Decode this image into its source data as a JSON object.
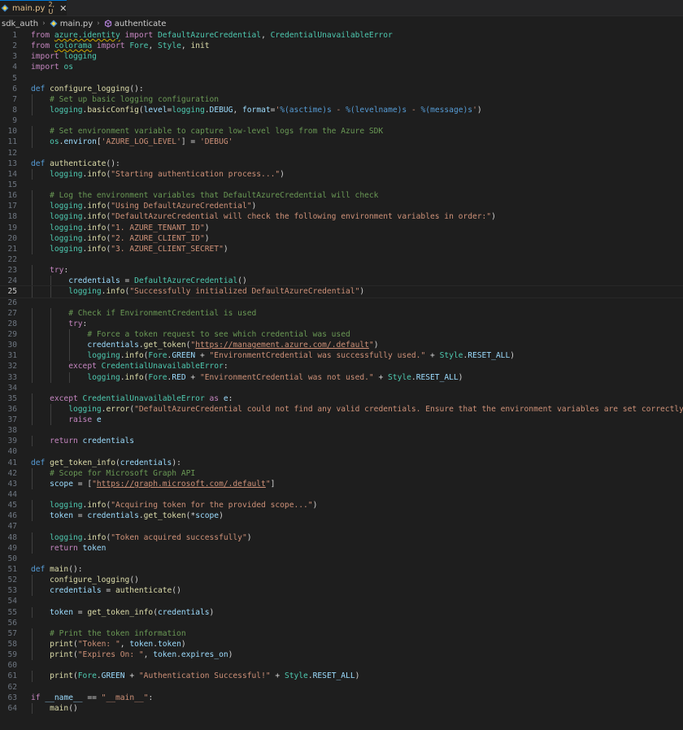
{
  "tab": {
    "filename": "main.py",
    "status": "2, U",
    "close_glyph": "✕",
    "file_icon": "python-icon",
    "accent": "#0078d4"
  },
  "breadcrumb": {
    "folder": "sdk_auth",
    "file": "main.py",
    "symbol": "authenticate",
    "separator": "›"
  },
  "editor": {
    "current_line": 25,
    "lines": [
      [
        [
          "kw",
          "from"
        ],
        [
          "pl",
          " "
        ],
        [
          "mod_sq",
          "azure.identity"
        ],
        [
          "pl",
          " "
        ],
        [
          "kw",
          "import"
        ],
        [
          "pl",
          " "
        ],
        [
          "cls",
          "DefaultAzureCredential"
        ],
        [
          "pl",
          ", "
        ],
        [
          "cls",
          "CredentialUnavailableError"
        ]
      ],
      [
        [
          "kw",
          "from"
        ],
        [
          "pl",
          " "
        ],
        [
          "mod_sq",
          "colorama"
        ],
        [
          "pl",
          " "
        ],
        [
          "kw",
          "import"
        ],
        [
          "pl",
          " "
        ],
        [
          "cls",
          "Fore"
        ],
        [
          "pl",
          ", "
        ],
        [
          "cls",
          "Style"
        ],
        [
          "pl",
          ", "
        ],
        [
          "fn",
          "init"
        ]
      ],
      [
        [
          "kw",
          "import"
        ],
        [
          "pl",
          " "
        ],
        [
          "mod",
          "logging"
        ]
      ],
      [
        [
          "kw",
          "import"
        ],
        [
          "pl",
          " "
        ],
        [
          "mod",
          "os"
        ]
      ],
      [],
      [
        [
          "def",
          "def"
        ],
        [
          "pl",
          " "
        ],
        [
          "fn",
          "configure_logging"
        ],
        [
          "pl",
          "():"
        ]
      ],
      [
        [
          "pl",
          "    "
        ],
        [
          "cmt",
          "# Set up basic logging configuration"
        ]
      ],
      [
        [
          "pl",
          "    "
        ],
        [
          "mod",
          "logging"
        ],
        [
          "pl",
          "."
        ],
        [
          "fn",
          "basicConfig"
        ],
        [
          "pl",
          "("
        ],
        [
          "var",
          "level"
        ],
        [
          "pl",
          "="
        ],
        [
          "mod",
          "logging"
        ],
        [
          "pl",
          "."
        ],
        [
          "var",
          "DEBUG"
        ],
        [
          "pl",
          ", "
        ],
        [
          "var",
          "format"
        ],
        [
          "pl",
          "="
        ],
        [
          "str",
          "'"
        ],
        [
          "fmt",
          "%(asctime)s"
        ],
        [
          "str",
          " - "
        ],
        [
          "fmt",
          "%(levelname)s"
        ],
        [
          "str",
          " - "
        ],
        [
          "fmt",
          "%(message)s"
        ],
        [
          "str",
          "'"
        ],
        [
          "pl",
          ")"
        ]
      ],
      [],
      [
        [
          "pl",
          "    "
        ],
        [
          "cmt",
          "# Set environment variable to capture low-level logs from the Azure SDK"
        ]
      ],
      [
        [
          "pl",
          "    "
        ],
        [
          "mod",
          "os"
        ],
        [
          "pl",
          "."
        ],
        [
          "var",
          "environ"
        ],
        [
          "pl",
          "["
        ],
        [
          "str",
          "'AZURE_LOG_LEVEL'"
        ],
        [
          "pl",
          "] = "
        ],
        [
          "str",
          "'DEBUG'"
        ]
      ],
      [],
      [
        [
          "def",
          "def"
        ],
        [
          "pl",
          " "
        ],
        [
          "fn",
          "authenticate"
        ],
        [
          "pl",
          "():"
        ]
      ],
      [
        [
          "pl",
          "    "
        ],
        [
          "mod",
          "logging"
        ],
        [
          "pl",
          "."
        ],
        [
          "fn",
          "info"
        ],
        [
          "pl",
          "("
        ],
        [
          "str",
          "\"Starting authentication process...\""
        ],
        [
          "pl",
          ")"
        ]
      ],
      [],
      [
        [
          "pl",
          "    "
        ],
        [
          "cmt",
          "# Log the environment variables that DefaultAzureCredential will check"
        ]
      ],
      [
        [
          "pl",
          "    "
        ],
        [
          "mod",
          "logging"
        ],
        [
          "pl",
          "."
        ],
        [
          "fn",
          "info"
        ],
        [
          "pl",
          "("
        ],
        [
          "str",
          "\"Using DefaultAzureCredential\""
        ],
        [
          "pl",
          ")"
        ]
      ],
      [
        [
          "pl",
          "    "
        ],
        [
          "mod",
          "logging"
        ],
        [
          "pl",
          "."
        ],
        [
          "fn",
          "info"
        ],
        [
          "pl",
          "("
        ],
        [
          "str",
          "\"DefaultAzureCredential will check the following environment variables in order:\""
        ],
        [
          "pl",
          ")"
        ]
      ],
      [
        [
          "pl",
          "    "
        ],
        [
          "mod",
          "logging"
        ],
        [
          "pl",
          "."
        ],
        [
          "fn",
          "info"
        ],
        [
          "pl",
          "("
        ],
        [
          "str",
          "\"1. AZURE_TENANT_ID\""
        ],
        [
          "pl",
          ")"
        ]
      ],
      [
        [
          "pl",
          "    "
        ],
        [
          "mod",
          "logging"
        ],
        [
          "pl",
          "."
        ],
        [
          "fn",
          "info"
        ],
        [
          "pl",
          "("
        ],
        [
          "str",
          "\"2. AZURE_CLIENT_ID\""
        ],
        [
          "pl",
          ")"
        ]
      ],
      [
        [
          "pl",
          "    "
        ],
        [
          "mod",
          "logging"
        ],
        [
          "pl",
          "."
        ],
        [
          "fn",
          "info"
        ],
        [
          "pl",
          "("
        ],
        [
          "str",
          "\"3. AZURE_CLIENT_SECRET\""
        ],
        [
          "pl",
          ")"
        ]
      ],
      [],
      [
        [
          "pl",
          "    "
        ],
        [
          "kw",
          "try"
        ],
        [
          "pl",
          ":"
        ]
      ],
      [
        [
          "pl",
          "        "
        ],
        [
          "var",
          "credentials"
        ],
        [
          "pl",
          " = "
        ],
        [
          "cls",
          "DefaultAzureCredential"
        ],
        [
          "pl",
          "()"
        ]
      ],
      [
        [
          "pl",
          "        "
        ],
        [
          "mod",
          "logging"
        ],
        [
          "pl",
          "."
        ],
        [
          "fn",
          "info"
        ],
        [
          "pl",
          "("
        ],
        [
          "str",
          "\"Successfully initialized DefaultAzureCredential\""
        ],
        [
          "pl",
          ")"
        ]
      ],
      [],
      [
        [
          "pl",
          "        "
        ],
        [
          "cmt",
          "# Check if EnvironmentCredential is used"
        ]
      ],
      [
        [
          "pl",
          "        "
        ],
        [
          "kw",
          "try"
        ],
        [
          "pl",
          ":"
        ]
      ],
      [
        [
          "pl",
          "            "
        ],
        [
          "cmt",
          "# Force a token request to see which credential was used"
        ]
      ],
      [
        [
          "pl",
          "            "
        ],
        [
          "var",
          "credentials"
        ],
        [
          "pl",
          "."
        ],
        [
          "fn",
          "get_token"
        ],
        [
          "pl",
          "("
        ],
        [
          "str",
          "\""
        ],
        [
          "str_u",
          "https://management.azure.com/.default"
        ],
        [
          "str",
          "\""
        ],
        [
          "pl",
          ")"
        ]
      ],
      [
        [
          "pl",
          "            "
        ],
        [
          "mod",
          "logging"
        ],
        [
          "pl",
          "."
        ],
        [
          "fn",
          "info"
        ],
        [
          "pl",
          "("
        ],
        [
          "cls",
          "Fore"
        ],
        [
          "pl",
          "."
        ],
        [
          "var",
          "GREEN"
        ],
        [
          "pl",
          " + "
        ],
        [
          "str",
          "\"EnvironmentCredential was successfully used.\""
        ],
        [
          "pl",
          " + "
        ],
        [
          "cls",
          "Style"
        ],
        [
          "pl",
          "."
        ],
        [
          "var",
          "RESET_ALL"
        ],
        [
          "pl",
          ")"
        ]
      ],
      [
        [
          "pl",
          "        "
        ],
        [
          "kw",
          "except"
        ],
        [
          "pl",
          " "
        ],
        [
          "cls",
          "CredentialUnavailableError"
        ],
        [
          "pl",
          ":"
        ]
      ],
      [
        [
          "pl",
          "            "
        ],
        [
          "mod",
          "logging"
        ],
        [
          "pl",
          "."
        ],
        [
          "fn",
          "info"
        ],
        [
          "pl",
          "("
        ],
        [
          "cls",
          "Fore"
        ],
        [
          "pl",
          "."
        ],
        [
          "var",
          "RED"
        ],
        [
          "pl",
          " + "
        ],
        [
          "str",
          "\"EnvironmentCredential was not used.\""
        ],
        [
          "pl",
          " + "
        ],
        [
          "cls",
          "Style"
        ],
        [
          "pl",
          "."
        ],
        [
          "var",
          "RESET_ALL"
        ],
        [
          "pl",
          ")"
        ]
      ],
      [],
      [
        [
          "pl",
          "    "
        ],
        [
          "kw",
          "except"
        ],
        [
          "pl",
          " "
        ],
        [
          "cls",
          "CredentialUnavailableError"
        ],
        [
          "pl",
          " "
        ],
        [
          "kw",
          "as"
        ],
        [
          "pl",
          " "
        ],
        [
          "var",
          "e"
        ],
        [
          "pl",
          ":"
        ]
      ],
      [
        [
          "pl",
          "        "
        ],
        [
          "mod",
          "logging"
        ],
        [
          "pl",
          "."
        ],
        [
          "fn",
          "error"
        ],
        [
          "pl",
          "("
        ],
        [
          "str",
          "\"DefaultAzureCredential could not find any valid credentials. Ensure that the environment variables are set correctly.\""
        ],
        [
          "pl",
          ")"
        ]
      ],
      [
        [
          "pl",
          "        "
        ],
        [
          "kw",
          "raise"
        ],
        [
          "pl",
          " "
        ],
        [
          "var",
          "e"
        ]
      ],
      [],
      [
        [
          "pl",
          "    "
        ],
        [
          "kw",
          "return"
        ],
        [
          "pl",
          " "
        ],
        [
          "var",
          "credentials"
        ]
      ],
      [],
      [
        [
          "def",
          "def"
        ],
        [
          "pl",
          " "
        ],
        [
          "fn",
          "get_token_info"
        ],
        [
          "pl",
          "("
        ],
        [
          "var",
          "credentials"
        ],
        [
          "pl",
          "):"
        ]
      ],
      [
        [
          "pl",
          "    "
        ],
        [
          "cmt",
          "# Scope for Microsoft Graph API"
        ]
      ],
      [
        [
          "pl",
          "    "
        ],
        [
          "var",
          "scope"
        ],
        [
          "pl",
          " = ["
        ],
        [
          "str",
          "\""
        ],
        [
          "str_u",
          "https://graph.microsoft.com/.default"
        ],
        [
          "str",
          "\""
        ],
        [
          "pl",
          "]"
        ]
      ],
      [],
      [
        [
          "pl",
          "    "
        ],
        [
          "mod",
          "logging"
        ],
        [
          "pl",
          "."
        ],
        [
          "fn",
          "info"
        ],
        [
          "pl",
          "("
        ],
        [
          "str",
          "\"Acquiring token for the provided scope...\""
        ],
        [
          "pl",
          ")"
        ]
      ],
      [
        [
          "pl",
          "    "
        ],
        [
          "var",
          "token"
        ],
        [
          "pl",
          " = "
        ],
        [
          "var",
          "credentials"
        ],
        [
          "pl",
          "."
        ],
        [
          "fn",
          "get_token"
        ],
        [
          "pl",
          "(*"
        ],
        [
          "var",
          "scope"
        ],
        [
          "pl",
          ")"
        ]
      ],
      [],
      [
        [
          "pl",
          "    "
        ],
        [
          "mod",
          "logging"
        ],
        [
          "pl",
          "."
        ],
        [
          "fn",
          "info"
        ],
        [
          "pl",
          "("
        ],
        [
          "str",
          "\"Token acquired successfully\""
        ],
        [
          "pl",
          ")"
        ]
      ],
      [
        [
          "pl",
          "    "
        ],
        [
          "kw",
          "return"
        ],
        [
          "pl",
          " "
        ],
        [
          "var",
          "token"
        ]
      ],
      [],
      [
        [
          "def",
          "def"
        ],
        [
          "pl",
          " "
        ],
        [
          "fn",
          "main"
        ],
        [
          "pl",
          "():"
        ]
      ],
      [
        [
          "pl",
          "    "
        ],
        [
          "fn",
          "configure_logging"
        ],
        [
          "pl",
          "()"
        ]
      ],
      [
        [
          "pl",
          "    "
        ],
        [
          "var",
          "credentials"
        ],
        [
          "pl",
          " = "
        ],
        [
          "fn",
          "authenticate"
        ],
        [
          "pl",
          "()"
        ]
      ],
      [],
      [
        [
          "pl",
          "    "
        ],
        [
          "var",
          "token"
        ],
        [
          "pl",
          " = "
        ],
        [
          "fn",
          "get_token_info"
        ],
        [
          "pl",
          "("
        ],
        [
          "var",
          "credentials"
        ],
        [
          "pl",
          ")"
        ]
      ],
      [],
      [
        [
          "pl",
          "    "
        ],
        [
          "cmt",
          "# Print the token information"
        ]
      ],
      [
        [
          "pl",
          "    "
        ],
        [
          "fn",
          "print"
        ],
        [
          "pl",
          "("
        ],
        [
          "str",
          "\"Token: \""
        ],
        [
          "pl",
          ", "
        ],
        [
          "var",
          "token"
        ],
        [
          "pl",
          "."
        ],
        [
          "var",
          "token"
        ],
        [
          "pl",
          ")"
        ]
      ],
      [
        [
          "pl",
          "    "
        ],
        [
          "fn",
          "print"
        ],
        [
          "pl",
          "("
        ],
        [
          "str",
          "\"Expires On: \""
        ],
        [
          "pl",
          ", "
        ],
        [
          "var",
          "token"
        ],
        [
          "pl",
          "."
        ],
        [
          "var",
          "expires_on"
        ],
        [
          "pl",
          ")"
        ]
      ],
      [],
      [
        [
          "pl",
          "    "
        ],
        [
          "fn",
          "print"
        ],
        [
          "pl",
          "("
        ],
        [
          "cls",
          "Fore"
        ],
        [
          "pl",
          "."
        ],
        [
          "var",
          "GREEN"
        ],
        [
          "pl",
          " + "
        ],
        [
          "str",
          "\"Authentication Successful!\""
        ],
        [
          "pl",
          " + "
        ],
        [
          "cls",
          "Style"
        ],
        [
          "pl",
          "."
        ],
        [
          "var",
          "RESET_ALL"
        ],
        [
          "pl",
          ")"
        ]
      ],
      [],
      [
        [
          "kw",
          "if"
        ],
        [
          "pl",
          " "
        ],
        [
          "var",
          "__name__"
        ],
        [
          "pl",
          " == "
        ],
        [
          "str",
          "\"__main__\""
        ],
        [
          "pl",
          ":"
        ]
      ],
      [
        [
          "pl",
          "    "
        ],
        [
          "fn",
          "main"
        ],
        [
          "pl",
          "()"
        ]
      ]
    ]
  }
}
